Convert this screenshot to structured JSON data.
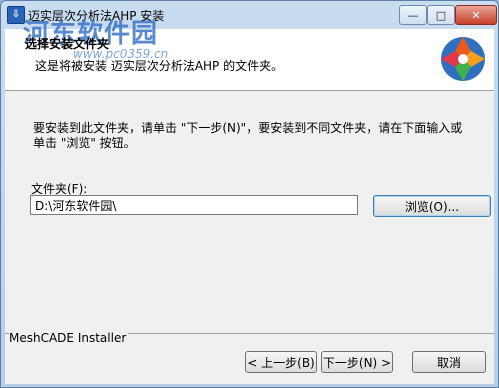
{
  "window": {
    "title": "迈实层次分析法AHP 安装",
    "controls": {
      "minimize": "—",
      "maximize": "□",
      "close": "✕"
    }
  },
  "watermark": {
    "name": "河东软件园",
    "url": "www.pc0359.cn"
  },
  "banner": {
    "title": "选择安装文件夹",
    "description": "这是将被安装 迈实层次分析法AHP 的文件夹。"
  },
  "body": {
    "instruction": "要安装到此文件夹，请单击 \"下一步(N)\"，要安装到不同文件夹，请在下面输入或单击 \"浏览\" 按钮。",
    "folder_label": "文件夹(F):",
    "folder_value": "D:\\河东软件园\\",
    "browse_label": "浏览(O)..."
  },
  "footer": {
    "installer_name": "MeshCADE Installer",
    "back_label": "< 上一步(B)",
    "next_label": "下一步(N) >",
    "cancel_label": "取消"
  },
  "icons": {
    "app": "installer-app-icon",
    "banner": "installer-logo-icon"
  }
}
